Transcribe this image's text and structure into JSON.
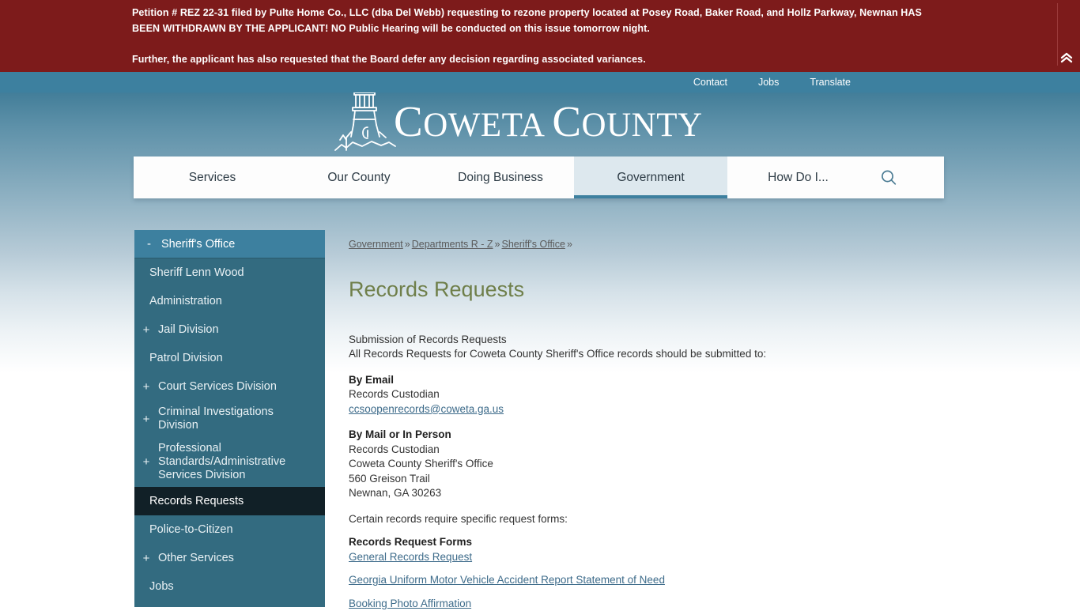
{
  "alert": {
    "line1": "Petition # REZ 22-31 filed by Pulte Home Co., LLC (dba Del Webb) requesting to rezone property located at Posey Road, Baker Road, and Hollz Parkway, Newnan HAS BEEN WITHDRAWN BY THE APPLICANT! NO Public Hearing will be conducted on this issue tomorrow night.",
    "line2": "Further, the applicant has also requested that the Board defer any decision regarding associated variances.",
    "collapse_icon": "double-chevron-up-icon"
  },
  "utility": {
    "links": [
      {
        "label": "Contact"
      },
      {
        "label": "Jobs"
      },
      {
        "label": "Translate"
      }
    ]
  },
  "masthead": {
    "logo_icon": "lighthouse-icon",
    "title_c": "C",
    "title_oweta": "OWETA ",
    "title_c2": "C",
    "title_ounty": "OUNTY",
    "title_full": "COWETA COUNTY"
  },
  "nav": {
    "items": [
      {
        "label": "Services",
        "active": false
      },
      {
        "label": "Our County",
        "active": false
      },
      {
        "label": "Doing Business",
        "active": false
      },
      {
        "label": "Government",
        "active": true
      },
      {
        "label": "How Do I...",
        "active": false
      }
    ],
    "search_icon": "search-icon"
  },
  "sidebar": {
    "header": {
      "label": "Sheriff's Office",
      "toggle": "-"
    },
    "items": [
      {
        "label": "Sheriff Lenn Wood",
        "toggle": "",
        "current": false
      },
      {
        "label": "Administration",
        "toggle": "",
        "current": false
      },
      {
        "label": "Jail Division",
        "toggle": "+",
        "current": false
      },
      {
        "label": "Patrol Division",
        "toggle": "",
        "current": false
      },
      {
        "label": "Court Services Division",
        "toggle": "+",
        "current": false
      },
      {
        "label": "Criminal Investigations Division",
        "toggle": "+",
        "current": false
      },
      {
        "label": "Professional Standards/Administrative Services Division",
        "toggle": "+",
        "current": false
      },
      {
        "label": "Records Requests",
        "toggle": "",
        "current": true
      },
      {
        "label": "Police-to-Citizen",
        "toggle": "",
        "current": false
      },
      {
        "label": "Other Services",
        "toggle": "+",
        "current": false
      },
      {
        "label": "Jobs",
        "toggle": "",
        "current": false
      }
    ]
  },
  "breadcrumb": {
    "items": [
      {
        "label": "Government"
      },
      {
        "label": "Departments R - Z"
      },
      {
        "label": "Sheriff's Office"
      }
    ],
    "separator": "»"
  },
  "page": {
    "title": "Records Requests",
    "intro_line1": "Submission of Records Requests",
    "intro_line2": "All Records Requests for Coweta County Sheriff's Office records should be submitted to:",
    "email_heading": "By Email",
    "email_custodian": "Records Custodian",
    "email_address": "ccsoopenrecords@coweta.ga.us",
    "mail_heading": "By Mail or In Person",
    "mail_custodian": "Records Custodian",
    "mail_office": "Coweta County Sheriff's Office",
    "mail_street": "560 Greison Trail",
    "mail_city": "Newnan, GA 30263",
    "forms_intro": "Certain records require specific request forms:",
    "forms_heading": "Records Request Forms",
    "form_links": [
      {
        "label": "General Records Request"
      },
      {
        "label": "Georgia Uniform Motor Vehicle Accident Report Statement of Need"
      },
      {
        "label": "Booking Photo Affirmation"
      }
    ]
  },
  "colors": {
    "alert_bg": "#7d1b1b",
    "brand_blue": "#3d809f",
    "sidebar_bg": "#336b80",
    "sidebar_active": "#112027",
    "title_green": "#6f7f4a",
    "link_blue": "#3d6b8a",
    "nav_active_bg": "#dde8ee"
  }
}
